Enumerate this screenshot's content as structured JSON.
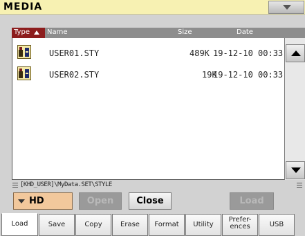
{
  "window": {
    "title": "MEDIA"
  },
  "columns": {
    "type": "Type",
    "name": "Name",
    "size": "Size",
    "date": "Date"
  },
  "files": [
    {
      "name": "USER01.STY",
      "size": "489K",
      "date": "19-12-10 00:33",
      "icon": "style-file-icon"
    },
    {
      "name": "USER02.STY",
      "size": "19K",
      "date": "19-12-10 00:33",
      "icon": "style-file-icon"
    }
  ],
  "path": "[KHD_USER]\\MyData.SET\\STYLE",
  "device": {
    "selected": "HD"
  },
  "buttons": {
    "open": "Open",
    "close": "Close",
    "load": "Load"
  },
  "tabs": [
    {
      "label": "Load",
      "selected": true
    },
    {
      "label": "Save"
    },
    {
      "label": "Copy"
    },
    {
      "label": "Erase"
    },
    {
      "label": "Format"
    },
    {
      "label": "Utility"
    },
    {
      "label": "Prefer-\nences"
    },
    {
      "label": "USB"
    }
  ],
  "colors": {
    "title_bar": "#f7f1b2",
    "header_bar": "#8d8d8d",
    "sort_column": "#8c1d1d",
    "device_select": "#f2c89c"
  }
}
